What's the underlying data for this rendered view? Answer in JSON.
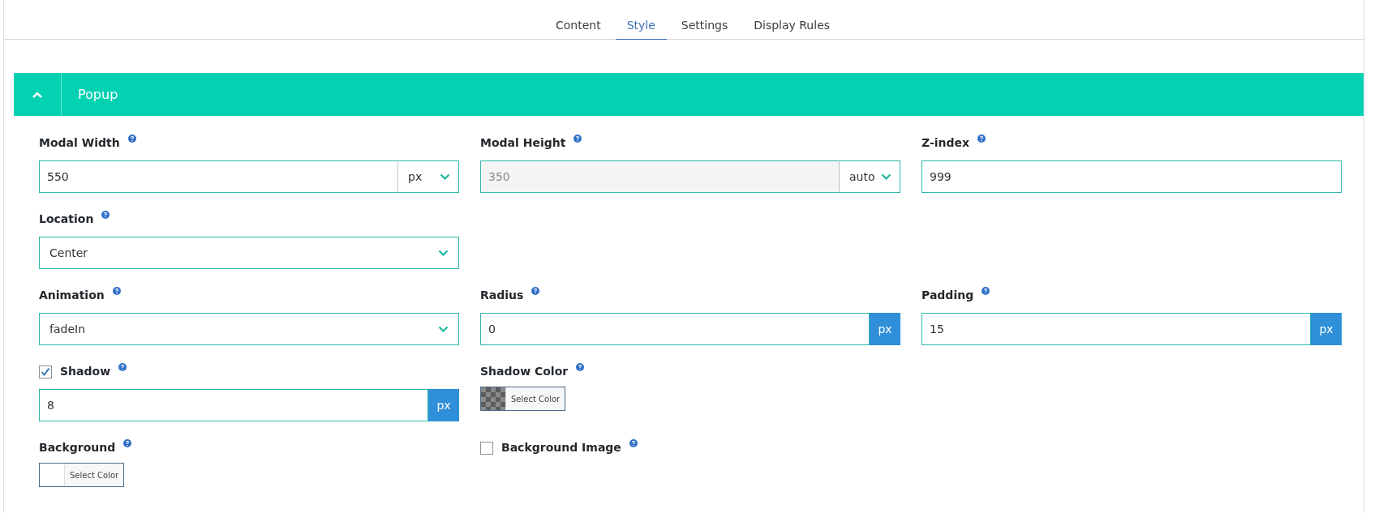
{
  "tabs": [
    {
      "label": "Content",
      "selected": false
    },
    {
      "label": "Style",
      "selected": true
    },
    {
      "label": "Settings",
      "selected": false
    },
    {
      "label": "Display Rules",
      "selected": false
    }
  ],
  "section": {
    "title": "Popup",
    "expanded": true
  },
  "rows": [
    [
      {
        "kind": "unit-select",
        "label": "Modal Width",
        "value": "550",
        "unit": "px",
        "disabled": false
      },
      {
        "kind": "unit-select",
        "label": "Modal Height",
        "value": "350",
        "unit": "auto",
        "disabled": true
      },
      {
        "kind": "text",
        "label": "Z-index",
        "value": "999",
        "disabled": false
      }
    ],
    [
      {
        "kind": "select",
        "label": "Location",
        "value": "Center"
      }
    ],
    [
      {
        "kind": "select",
        "label": "Animation",
        "value": "fadeIn"
      },
      {
        "kind": "unit-addon",
        "label": "Radius",
        "value": "0",
        "unit": "px"
      },
      {
        "kind": "unit-addon",
        "label": "Padding",
        "value": "15",
        "unit": "px"
      }
    ],
    [
      {
        "kind": "unit-addon",
        "label": "Shadow",
        "value": "8",
        "unit": "px",
        "checked": true
      },
      {
        "kind": "color",
        "label": "Shadow Color",
        "button": "Select Color",
        "transparent": true
      }
    ],
    [
      {
        "kind": "color",
        "label": "Background",
        "button": "Select Color",
        "transparent": false
      },
      {
        "kind": "checkbox",
        "label": "Background Image",
        "checked": false
      }
    ]
  ]
}
